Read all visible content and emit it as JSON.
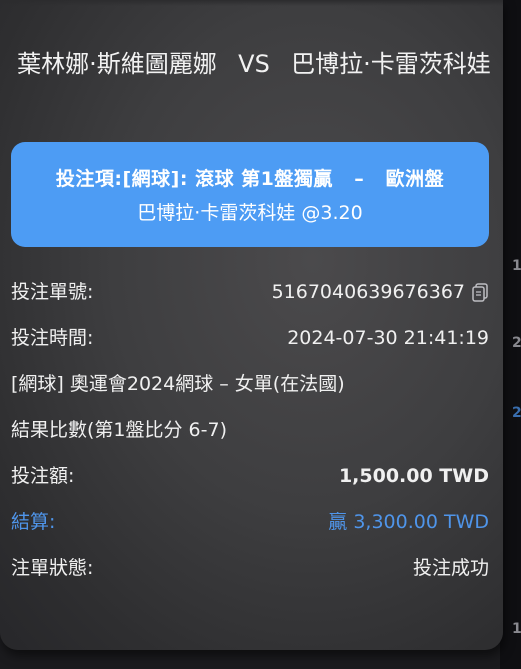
{
  "match": {
    "home_team": "葉林娜·斯維圖麗娜",
    "vs": "VS",
    "away_team": "巴博拉·卡雷茨科娃"
  },
  "bet": {
    "line1": "投注項:[網球]: 滾球 第1盤獨贏   –   歐洲盤",
    "line2": "巴博拉·卡雷茨科娃 @3.20"
  },
  "details": {
    "ticket_label": "投注單號:",
    "ticket_value": "5167040639676367",
    "time_label": "投注時間:",
    "time_value": "2024-07-30 21:41:19",
    "event": "[網球] 奧運會2024網球 – 女單(在法國)",
    "result": "結果比數(第1盤比分 6-7)",
    "stake_label": "投注額:",
    "stake_value": "1,500.00 TWD",
    "settle_label": "結算:",
    "settle_value": "贏 3,300.00 TWD",
    "status_label": "注單狀態:",
    "status_value": "投注成功"
  },
  "edge_marks": [
    "1",
    "2",
    "2",
    "1"
  ],
  "icons": {
    "copy": "copy-icon"
  },
  "colors": {
    "accent_blue": "#4d9cf4",
    "settle_blue": "#4f95ea"
  }
}
